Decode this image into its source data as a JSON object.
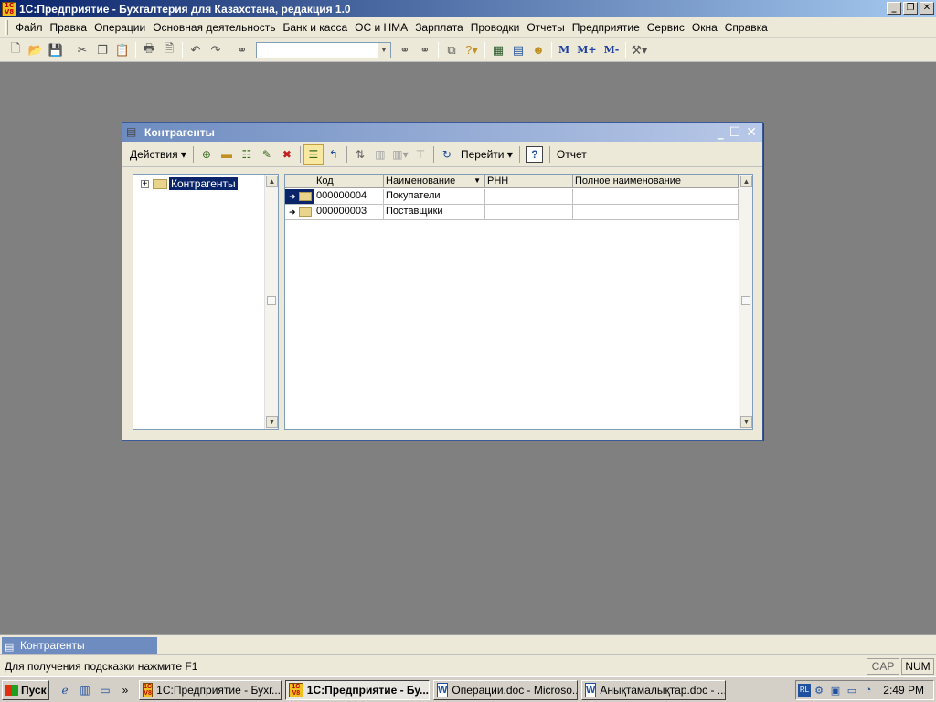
{
  "app": {
    "icon_text": "1C\nV8",
    "title": "1С:Предприятие - Бухгалтерия для Казахстана, редакция 1.0",
    "window_buttons": [
      "_",
      "❐",
      "✕"
    ]
  },
  "menu": [
    "Файл",
    "Правка",
    "Операции",
    "Основная деятельность",
    "Банк и касса",
    "ОС и НМА",
    "Зарплата",
    "Проводки",
    "Отчеты",
    "Предприятие",
    "Сервис",
    "Окна",
    "Справка"
  ],
  "toolbar": {
    "search_value": "",
    "m_buttons": [
      "M",
      "M+",
      "M-"
    ]
  },
  "child": {
    "title": "Контрагенты",
    "buttons": [
      "_",
      "☐",
      "✕"
    ],
    "actions_label": "Действия",
    "goto_label": "Перейти",
    "help_label": "?",
    "report_label": "Отчет",
    "tree": {
      "expander": "+",
      "root_label": "Контрагенты"
    },
    "grid": {
      "columns": [
        "",
        "Код",
        "Наименование",
        "РНН",
        "Полное наименование"
      ],
      "rows": [
        {
          "code": "000000004",
          "name": "Покупатели",
          "rnn": "",
          "full_name": ""
        },
        {
          "code": "000000003",
          "name": "Поставщики",
          "rnn": "",
          "full_name": ""
        }
      ]
    }
  },
  "mdi_tab": "Контрагенты",
  "status": {
    "hint": "Для получения подсказки нажмите F1",
    "cap": "CAP",
    "num": "NUM"
  },
  "taskbar": {
    "start_label": "Пуск",
    "tasks": [
      {
        "label": "1С:Предприятие - Бухг...",
        "icon": "1c"
      },
      {
        "label": "1С:Предприятие - Бу...",
        "icon": "1c"
      },
      {
        "label": "Операции.doc - Microso...",
        "icon": "word"
      },
      {
        "label": "Анықтамалықтар.doc - ...",
        "icon": "word"
      }
    ],
    "lang": "RL",
    "clock": "2:49 PM"
  }
}
